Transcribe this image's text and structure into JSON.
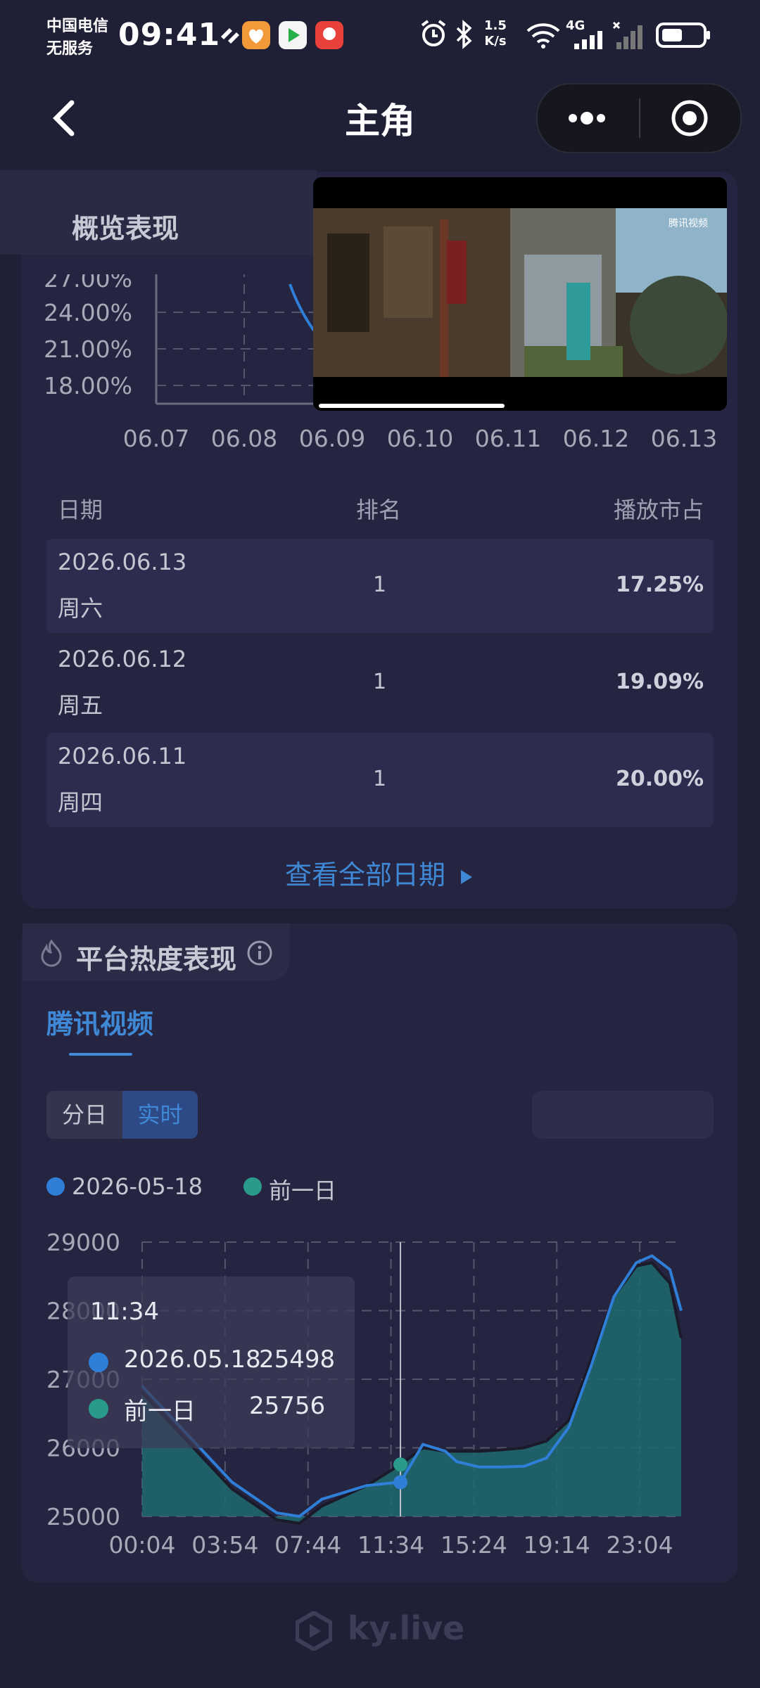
{
  "status_bar": {
    "carrier_line1": "中国电信",
    "carrier_line2": "无服务",
    "time": "09:41",
    "speed_value": "1.5",
    "speed_unit": "K/s",
    "network": "4G"
  },
  "nav": {
    "title": "主角",
    "back_icon": "chevron-left-icon",
    "menu_icon": "more-dots-icon",
    "close_icon": "target-icon"
  },
  "overview": {
    "section_label": "概览表现",
    "chart_data": {
      "type": "line",
      "title": "",
      "y_ticks": [
        "24.00%",
        "21.00%",
        "18.00%"
      ],
      "y_ticks_partial": "27.00%",
      "x": [
        "06.07",
        "06.08",
        "06.09",
        "06.10",
        "06.11",
        "06.12",
        "06.13"
      ],
      "series": [
        {
          "values": [
            null,
            null,
            24.5,
            null,
            20.0,
            19.09,
            17.25
          ]
        }
      ],
      "grid": true
    },
    "table": {
      "headers": {
        "date": "日期",
        "rank": "排名",
        "share": "播放市占"
      },
      "rows": [
        {
          "date": "2026.06.13",
          "weekday": "周六",
          "rank": "1",
          "share": "17.25%"
        },
        {
          "date": "2026.06.12",
          "weekday": "周五",
          "rank": "1",
          "share": "19.09%"
        },
        {
          "date": "2026.06.11",
          "weekday": "周四",
          "rank": "1",
          "share": "20.00%"
        }
      ]
    },
    "view_all_label": "查看全部日期"
  },
  "video_overlay": {
    "watermark": "腾讯视频",
    "progress": 0.45
  },
  "platform": {
    "section_title": "平台热度表现",
    "section_icon": "flame-icon",
    "info_icon": "info-icon",
    "tab_label": "腾讯视频",
    "segments": [
      "分日",
      "实时"
    ],
    "active_segment": "实时",
    "legend": [
      "2026-05-18",
      "前一日"
    ],
    "tooltip": {
      "time": "11:34",
      "row1_label": "2026.05.18",
      "row1_value": "25498",
      "row2_label": "前一日",
      "row2_value": "25756"
    },
    "chart_data": {
      "type": "area",
      "y_ticks": [
        "29000",
        "28000",
        "27000",
        "26000",
        "25000"
      ],
      "ylim": [
        25000,
        29000
      ],
      "x_ticks": [
        "00:04",
        "03:54",
        "07:44",
        "11:34",
        "15:24",
        "19:14",
        "23:04"
      ],
      "x_hours": [
        0,
        2,
        4,
        6,
        7,
        8,
        9,
        10,
        11.5,
        12.5,
        13.5,
        14,
        15,
        16,
        17,
        18,
        19,
        20,
        21,
        22,
        22.7,
        23.5,
        24
      ],
      "series": [
        {
          "name": "2026-05-18",
          "color": "#2f7fd8",
          "values": [
            26900,
            26200,
            25500,
            25050,
            25000,
            25250,
            25350,
            25450,
            25500,
            26050,
            25950,
            25800,
            25720,
            25720,
            25730,
            25850,
            26300,
            27200,
            28200,
            28700,
            28800,
            28600,
            28000
          ]
        },
        {
          "name": "前一日",
          "color": "#2a9a8a",
          "values": [
            26800,
            26100,
            25400,
            24950,
            24900,
            25150,
            25300,
            25450,
            25756,
            26000,
            25950,
            25950,
            25950,
            25970,
            26000,
            26100,
            26400,
            27300,
            28200,
            28650,
            28700,
            28400,
            27600
          ]
        }
      ],
      "marker_x": 11.5,
      "grid": true
    }
  },
  "footer": {
    "brand": "ky.live"
  }
}
